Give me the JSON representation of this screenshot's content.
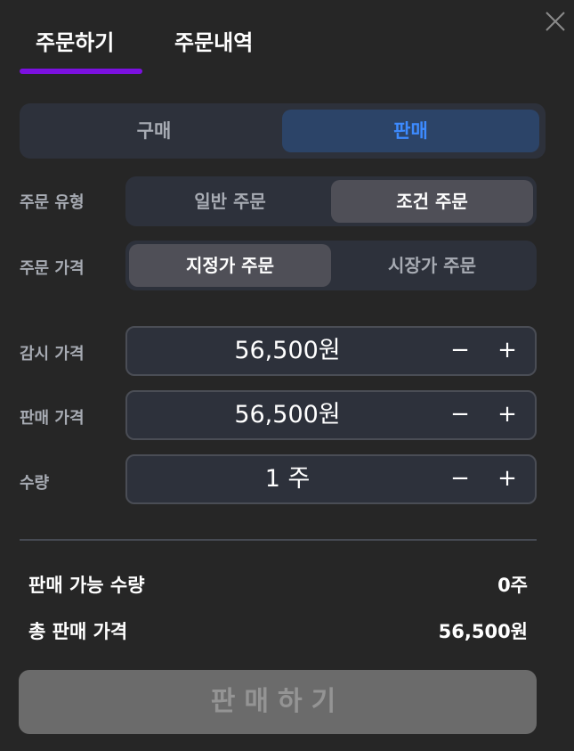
{
  "tabs": {
    "order": "주문하기",
    "history": "주문내역"
  },
  "trade_side": {
    "buy": "구매",
    "sell": "판매",
    "selected": "sell"
  },
  "order_type": {
    "label": "주문 유형",
    "options": [
      "일반 주문",
      "조건 주문"
    ],
    "selected": "조건 주문"
  },
  "order_price_type": {
    "label": "주문 가격",
    "options": [
      "지정가 주문",
      "시장가 주문"
    ],
    "selected": "지정가 주문"
  },
  "watch_price": {
    "label": "감시 가격",
    "value": "56,500원"
  },
  "sell_price": {
    "label": "판매 가격",
    "value": "56,500원"
  },
  "quantity": {
    "label": "수량",
    "value": "1 주"
  },
  "stepper_symbols": {
    "minus": "−",
    "plus": "+"
  },
  "summary": {
    "available_label": "판매 가능 수량",
    "available_value": "0주",
    "total_label": "총 판매 가격",
    "total_value": "56,500원"
  },
  "submit_label": "판매하기",
  "colors": {
    "background": "#262626",
    "tab_underline": "#7b10e0",
    "sell_accent": "#3d8bff",
    "sell_bg": "#2c4468",
    "submit_disabled": "#6b6b6b"
  }
}
